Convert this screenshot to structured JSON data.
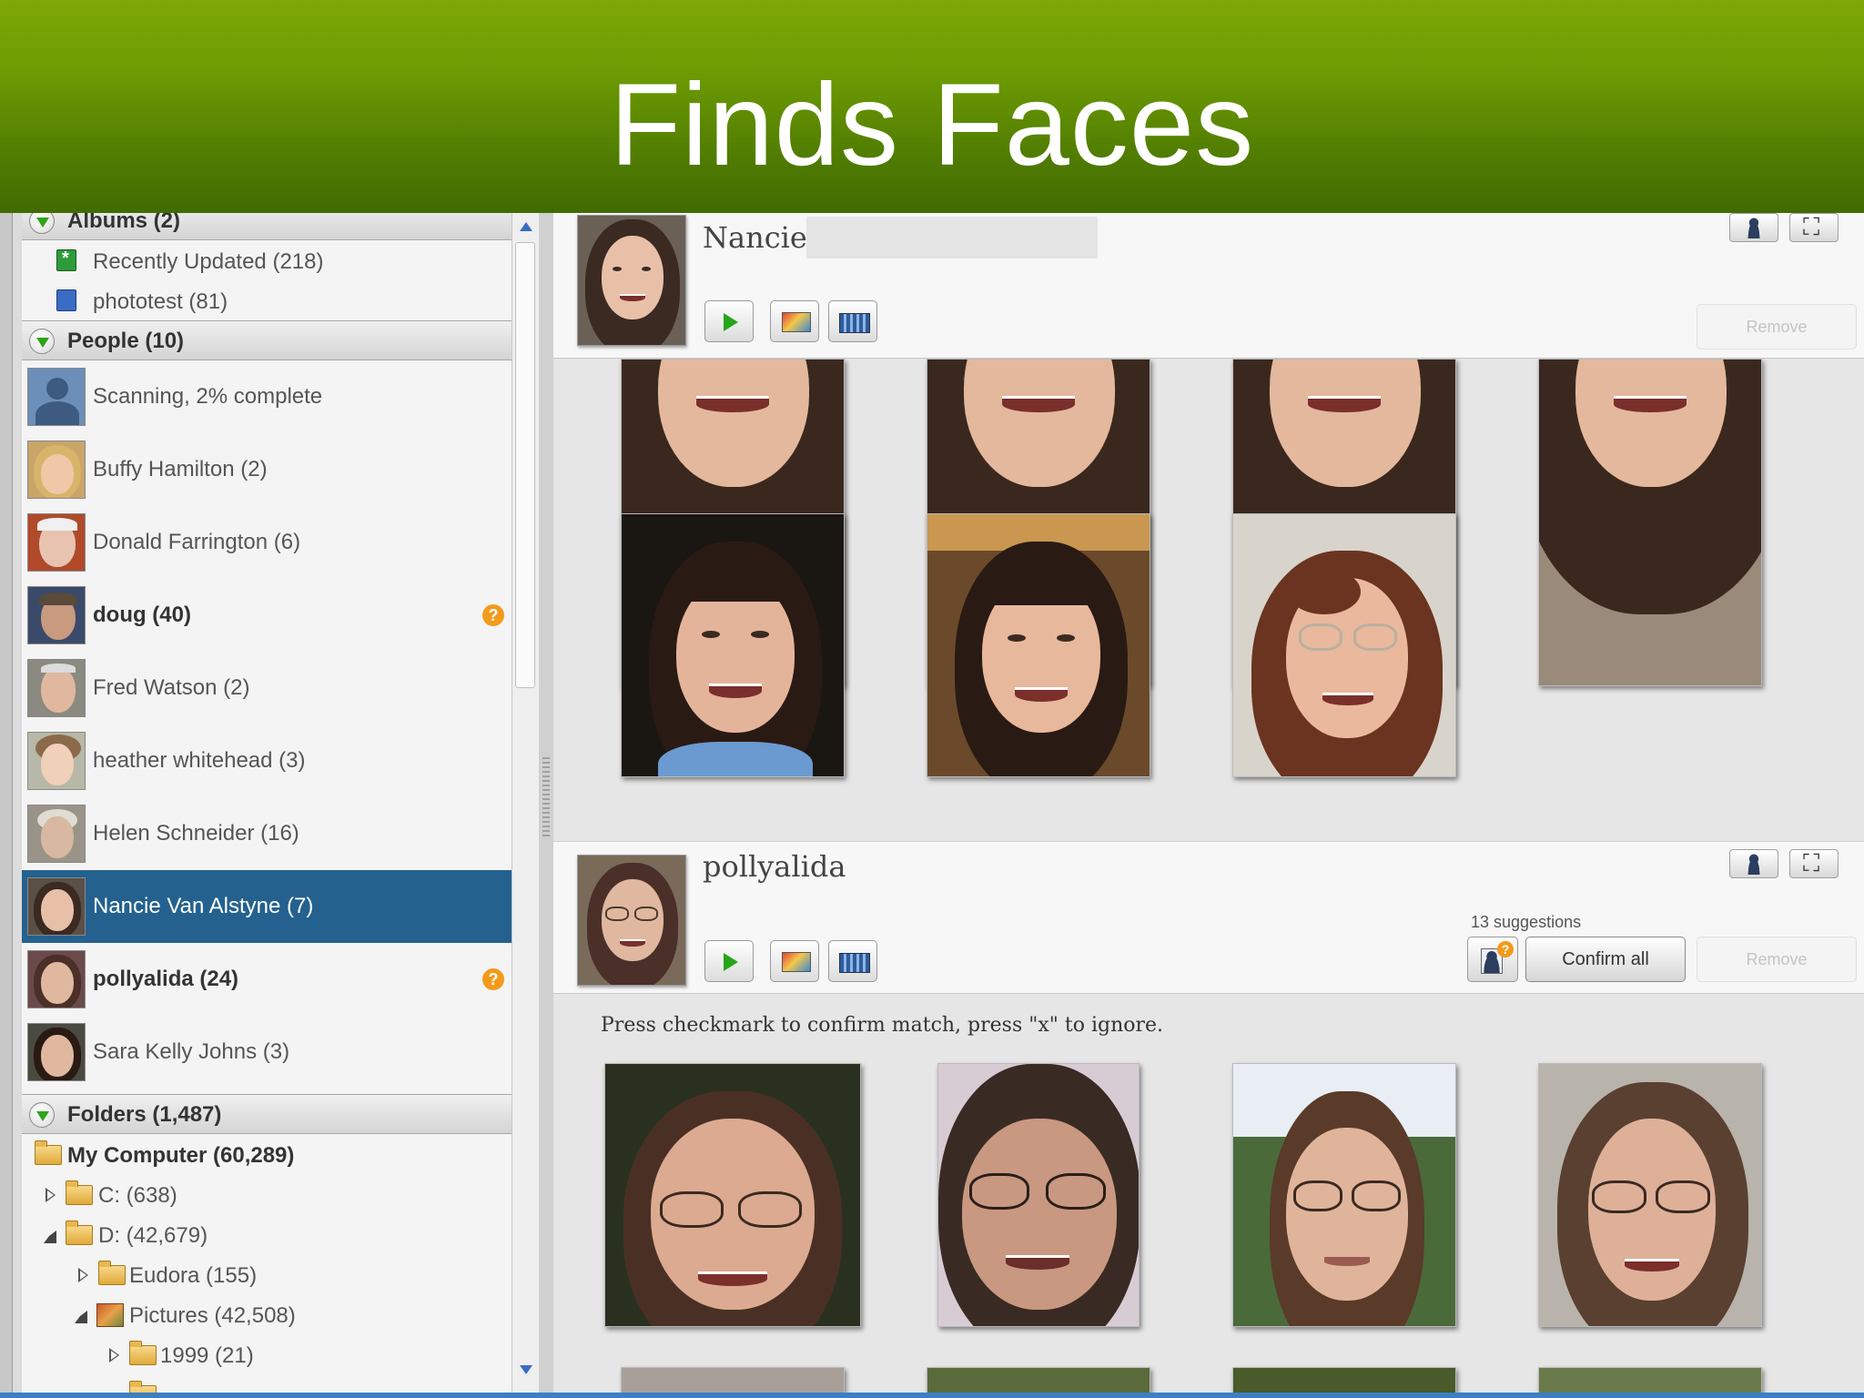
{
  "slide": {
    "title": "Finds Faces"
  },
  "sidebar": {
    "albums_header": "Albums (2)",
    "albums": [
      {
        "label": "Recently Updated (218)",
        "icon": "recently-updated-album-icon"
      },
      {
        "label": "phototest (81)",
        "icon": "album-icon"
      }
    ],
    "people_header": "People (10)",
    "people": [
      {
        "label": "Scanning, 2% complete",
        "bold": false,
        "selected": false,
        "question": false
      },
      {
        "label": "Buffy Hamilton (2)",
        "bold": false,
        "selected": false,
        "question": false
      },
      {
        "label": "Donald Farrington (6)",
        "bold": false,
        "selected": false,
        "question": false
      },
      {
        "label": "doug (40)",
        "bold": true,
        "selected": false,
        "question": true
      },
      {
        "label": "Fred Watson (2)",
        "bold": false,
        "selected": false,
        "question": false
      },
      {
        "label": "heather whitehead (3)",
        "bold": false,
        "selected": false,
        "question": false
      },
      {
        "label": "Helen Schneider (16)",
        "bold": false,
        "selected": false,
        "question": false
      },
      {
        "label": "Nancie Van Alstyne (7)",
        "bold": false,
        "selected": true,
        "question": false
      },
      {
        "label": "pollyalida (24)",
        "bold": true,
        "selected": false,
        "question": true
      },
      {
        "label": "Sara Kelly Johns (3)",
        "bold": false,
        "selected": false,
        "question": false
      }
    ],
    "question_mark": "?",
    "folders_header": "Folders (1,487)",
    "folders": [
      {
        "label": "My Computer (60,289)",
        "bold": true
      },
      {
        "label": "C: (638)",
        "bold": false
      },
      {
        "label": "D: (42,679)",
        "bold": false
      },
      {
        "label": "Eudora (155)",
        "bold": false
      },
      {
        "label": "Pictures (42,508)",
        "bold": false
      },
      {
        "label": "1999 (21)",
        "bold": false
      }
    ]
  },
  "main": {
    "person1": {
      "name": "Nancie",
      "remove_label": "Remove"
    },
    "person2": {
      "name": "pollyalida",
      "suggestions": "13 suggestions",
      "confirm_label": "Confirm all",
      "remove_label": "Remove",
      "instruction": "Press checkmark to confirm match, press \"x\" to ignore."
    }
  },
  "colors": {
    "banner_green": "#6d9a03",
    "selection_blue": "#24618f",
    "question_badge": "#f39a1b",
    "play_green": "#27a51a"
  }
}
